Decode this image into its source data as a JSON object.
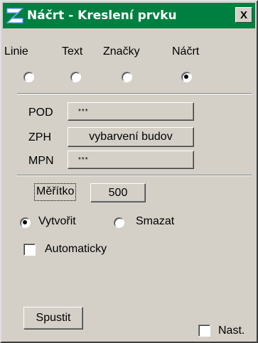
{
  "window": {
    "title": "Náčrt - Kreslení prvku",
    "close_label": "X",
    "title_color": "#008040"
  },
  "modes": [
    {
      "label": "Linie",
      "checked": false
    },
    {
      "label": "Text",
      "checked": false
    },
    {
      "label": "Značky",
      "checked": false
    },
    {
      "label": "Náčrt",
      "checked": true
    }
  ],
  "fields": [
    {
      "label": "POD",
      "value": "***"
    },
    {
      "label": "ZPH",
      "value": "vybarvení budov"
    },
    {
      "label": "MPN",
      "value": "***"
    }
  ],
  "scale": {
    "label": "Měřítko",
    "value": "500"
  },
  "action": {
    "create_label": "Vytvořit",
    "delete_label": "Smazat",
    "selected": "create"
  },
  "automatic": {
    "label": "Automaticky",
    "checked": false
  },
  "run_label": "Spustit",
  "settings": {
    "label": "Nast.",
    "checked": false
  }
}
